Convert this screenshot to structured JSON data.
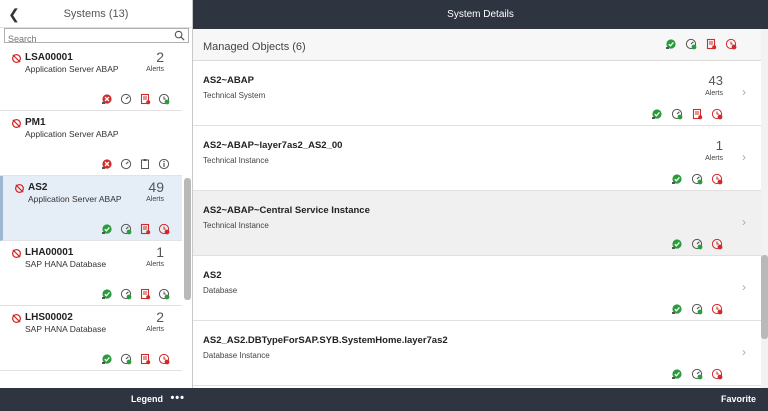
{
  "master": {
    "title": "Systems (13)",
    "search_placeholder": "Search",
    "items": [
      {
        "name": "LSA00001",
        "desc": "Application Server ABAP",
        "count": "2",
        "alerts": "Alerts",
        "icons": [
          "red-circle-x-icon",
          "gauge-icon",
          "red-document-icon",
          "green-check-clock-icon"
        ]
      },
      {
        "name": "PM1",
        "desc": "Application Server ABAP",
        "count": "",
        "alerts": "",
        "icons": [
          "red-circle-x-icon",
          "gauge-icon",
          "clipboard-icon",
          "info-icon"
        ]
      },
      {
        "name": "AS2",
        "desc": "Application Server ABAP",
        "count": "49",
        "alerts": "Alerts",
        "icons": [
          "green-circle-check-icon",
          "green-gauge-icon",
          "red-document-icon",
          "red-clock-icon"
        ]
      },
      {
        "name": "LHA00001",
        "desc": "SAP HANA Database",
        "count": "1",
        "alerts": "Alerts",
        "icons": [
          "green-circle-check-icon",
          "green-gauge-icon",
          "red-document-icon",
          "green-check-clock-icon"
        ]
      },
      {
        "name": "LHS00002",
        "desc": "SAP HANA Database",
        "count": "2",
        "alerts": "Alerts",
        "icons": [
          "green-circle-check-icon",
          "green-gauge-icon",
          "red-document-icon",
          "red-clock-icon"
        ]
      }
    ],
    "footer": {
      "legend": "Legend",
      "more": "•••"
    }
  },
  "detail": {
    "title": "System Details",
    "objects_title": "Managed Objects (6)",
    "objects": [
      {
        "title": "AS2~ABAP",
        "sub": "Technical System",
        "count": "43",
        "alerts": "Alerts",
        "icons": [
          "green-circle-check-icon",
          "green-gauge-icon",
          "red-document-icon",
          "red-clock-icon"
        ]
      },
      {
        "title": "AS2~ABAP~layer7as2_AS2_00",
        "sub": "Technical Instance",
        "count": "1",
        "alerts": "Alerts",
        "icons": [
          "green-circle-check-icon",
          "green-gauge-icon",
          "red-clock-icon"
        ]
      },
      {
        "title": "AS2~ABAP~Central Service Instance",
        "sub": "Technical Instance",
        "count": "",
        "alerts": "",
        "icons": [
          "green-circle-check-icon",
          "green-gauge-icon",
          "red-clock-icon"
        ]
      },
      {
        "title": "AS2",
        "sub": "Database",
        "count": "",
        "alerts": "",
        "icons": [
          "green-circle-check-icon",
          "green-gauge-icon",
          "red-clock-icon"
        ]
      },
      {
        "title": "AS2_AS2.DBTypeForSAP.SYB.SystemHome.layer7as2",
        "sub": "Database Instance",
        "count": "",
        "alerts": "",
        "icons": [
          "green-circle-check-icon",
          "green-gauge-icon",
          "red-clock-icon"
        ]
      }
    ],
    "footer": {
      "favorite": "Favorite"
    }
  },
  "colors": {
    "bar": "#2e3440",
    "ok": "#2a9c3b",
    "error": "#d12a2a",
    "selected": "#e5edf7"
  }
}
